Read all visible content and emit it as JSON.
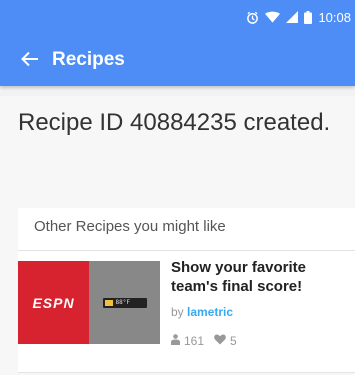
{
  "status_bar": {
    "time": "10:08"
  },
  "app_bar": {
    "title": "Recipes",
    "back_icon": "arrow-left-icon"
  },
  "message": "Recipe ID 40884235 created.",
  "recommendations": {
    "heading": "Other Recipes you might like",
    "items": [
      {
        "title": "Show your favorite team's final score!",
        "by_prefix": "by",
        "author": "lametric",
        "user_count": "161",
        "like_count": "5",
        "image": {
          "left_text": "ESPN",
          "device_text": "88°F",
          "left_color": "#d6232f"
        }
      }
    ]
  },
  "colors": {
    "accent": "#4d8df5",
    "author": "#38aaf2"
  }
}
